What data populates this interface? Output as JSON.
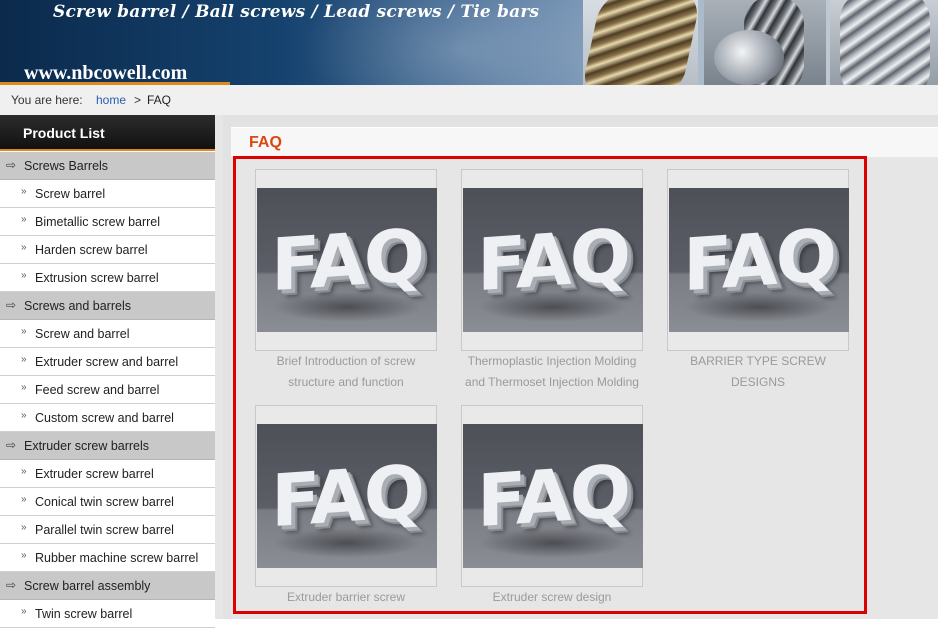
{
  "banner": {
    "tagline": "Screw barrel / Ball screws / Lead screws / Tie bars",
    "url": "www.nbcowell.com"
  },
  "breadcrumb": {
    "label": "You are here:",
    "home": "home",
    "separator": ">",
    "current": "FAQ"
  },
  "sidebar": {
    "title": "Product List",
    "rows": [
      {
        "type": "category",
        "label": "Screws Barrels"
      },
      {
        "type": "item",
        "label": "Screw barrel"
      },
      {
        "type": "item",
        "label": "Bimetallic screw barrel"
      },
      {
        "type": "item",
        "label": "Harden screw barrel"
      },
      {
        "type": "item",
        "label": "Extrusion screw barrel"
      },
      {
        "type": "category",
        "label": "Screws and barrels"
      },
      {
        "type": "item",
        "label": "Screw and barrel"
      },
      {
        "type": "item",
        "label": "Extruder screw and barrel"
      },
      {
        "type": "item",
        "label": "Feed screw and barrel"
      },
      {
        "type": "item",
        "label": "Custom screw and barrel"
      },
      {
        "type": "category",
        "label": "Extruder screw barrels"
      },
      {
        "type": "item",
        "label": "Extruder screw barrel"
      },
      {
        "type": "item",
        "label": "Conical twin screw barrel"
      },
      {
        "type": "item",
        "label": "Parallel twin screw barrel"
      },
      {
        "type": "item",
        "label": "Rubber machine screw barrel"
      },
      {
        "type": "category",
        "label": "Screw barrel assembly"
      },
      {
        "type": "item",
        "label": "Twin screw barrel"
      }
    ]
  },
  "main": {
    "title": "FAQ",
    "cards": [
      {
        "image_text": "FAQ",
        "caption_lines": [
          "Brief Introduction of screw",
          "structure and function"
        ]
      },
      {
        "image_text": "FAQ",
        "caption_lines": [
          "Thermoplastic Injection Molding",
          "and Thermoset Injection Molding"
        ]
      },
      {
        "image_text": "FAQ",
        "caption_lines": [
          "BARRIER TYPE SCREW",
          "DESIGNS"
        ]
      },
      {
        "image_text": "FAQ",
        "caption_lines": [
          "Extruder barrier screw"
        ]
      },
      {
        "image_text": "FAQ",
        "caption_lines": [
          "Extruder screw design"
        ]
      }
    ]
  },
  "colors": {
    "accent": "#d9480f",
    "highlight_border": "#dd0000",
    "link": "#2a5db0"
  }
}
